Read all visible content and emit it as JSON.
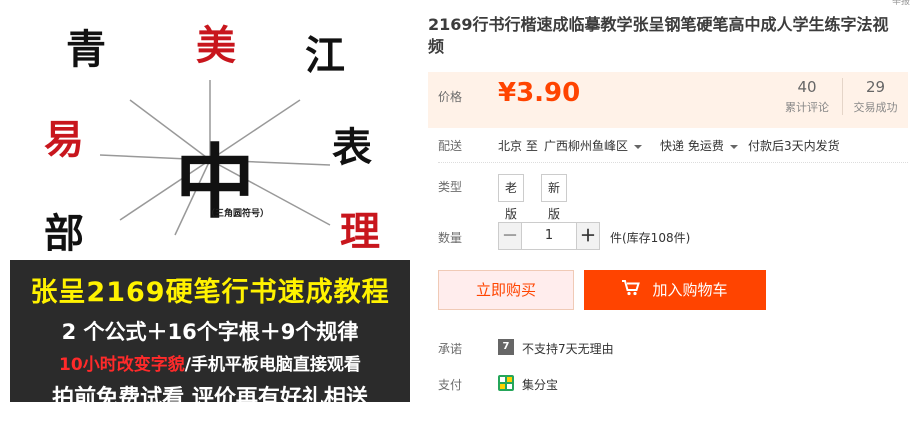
{
  "gallery": {
    "chars": [
      "青",
      "美",
      "江",
      "易",
      "表",
      "部",
      "理",
      "中"
    ],
    "center_char": "中",
    "center_caption": "（三角圆符号）",
    "banner": {
      "line1": "张呈2169硬笔行书速成教程",
      "line2": "2 个公式＋16个字根＋9个规律",
      "line3_a": "10小时改变字貌",
      "line3_b": "/手机平板电脑直接观看",
      "line4": "拍前免费试看 评价再有好礼相送"
    }
  },
  "product": {
    "corner_tag": "举报",
    "title": "2169行书行楷速成临摹教学张呈钢笔硬笔高中成人学生练字法视频",
    "price_label": "价格",
    "price": "¥3.90",
    "stats": [
      {
        "num": "40",
        "label": "累计评论"
      },
      {
        "num": "29",
        "label": "交易成功"
      }
    ],
    "shipping": {
      "label": "配送",
      "from": "北京 至",
      "to": "广西柳州鱼峰区",
      "method": "快递 免运费",
      "dispatch": "付款后3天内发货"
    },
    "type": {
      "label": "类型",
      "options": [
        "老版",
        "新版"
      ]
    },
    "quantity": {
      "label": "数量",
      "value": "1",
      "minus": "－",
      "plus": "＋",
      "stock": "件(库存108件)"
    },
    "buttons": {
      "buy_now": "立即购买",
      "add_cart": "加入购物车"
    },
    "promise": {
      "label": "承诺",
      "badge": "7",
      "text": "不支持7天无理由"
    },
    "payment": {
      "label": "支付",
      "text": "集分宝"
    }
  },
  "colors": {
    "accent": "#ff4400",
    "price": "#ff4400",
    "price_bg": "#fff2e8"
  }
}
